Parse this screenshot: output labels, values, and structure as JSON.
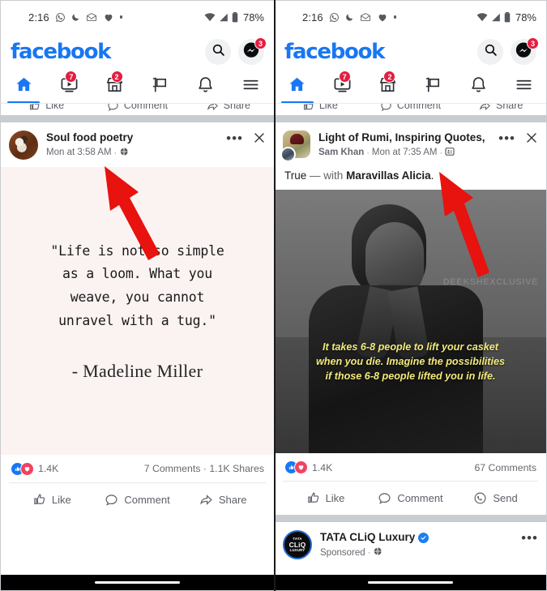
{
  "status_bar": {
    "time": "2:16",
    "battery_text": "78%",
    "left_icons": [
      "whatsapp-icon",
      "do-not-disturb-moon-icon",
      "email-icon",
      "heart-icon",
      "more-dot-icon"
    ],
    "right_icons": [
      "wifi-icon",
      "cellular-signal-icon",
      "battery-icon"
    ]
  },
  "app_bar": {
    "logo_text": "facebook",
    "logo_color": "#1877f2",
    "search_icon": "search-icon",
    "messenger_icon": "messenger-icon",
    "messenger_badge": "3",
    "badge_color": "#e41e3f"
  },
  "tabs": [
    {
      "name": "home",
      "icon": "home-icon",
      "badge": null,
      "selected": true
    },
    {
      "name": "video",
      "icon": "video-play-icon",
      "badge": "7",
      "selected": false
    },
    {
      "name": "marketplace",
      "icon": "marketplace-store-icon",
      "badge": "2",
      "selected": false
    },
    {
      "name": "groups",
      "icon": "groups-flag-icon",
      "badge": null,
      "selected": false
    },
    {
      "name": "notifications",
      "icon": "bell-icon",
      "badge": null,
      "selected": false
    },
    {
      "name": "menu",
      "icon": "hamburger-menu-icon",
      "badge": null,
      "selected": false
    }
  ],
  "clipped_actions": {
    "like": "Like",
    "comment": "Comment",
    "share": "Share"
  },
  "left_panel": {
    "post": {
      "avatar": "soul-food-poetry-avatar",
      "title": "Soul food poetry",
      "timestamp": "Mon at 3:58 AM",
      "separator": "·",
      "privacy_icon": "globe-public-icon",
      "more_icon": "more-options-icon",
      "close_icon": "close-icon",
      "quote_lines": [
        "\"Life is not so simple",
        "as a loom. What you",
        "weave, you cannot",
        "unravel with a tug.\""
      ],
      "quote_author": "- Madeline Miller",
      "card_bg": "#faf3f2"
    },
    "engagement": {
      "reactions_count": "1.4K",
      "reaction_icons": [
        "like-reaction-icon",
        "love-reaction-icon"
      ],
      "comments_shares": "7 Comments · 1.1K Shares"
    },
    "actions": {
      "like": "Like",
      "comment": "Comment",
      "share": "Share"
    }
  },
  "right_panel": {
    "post": {
      "avatar": "light-of-rumi-page-avatar",
      "mini_avatar": "sam-khan-profile-avatar",
      "title": "Light of Rumi, Inspiring Quotes,",
      "author": "Sam Khan",
      "timestamp": "Mon at 7:35 AM",
      "separator": "·",
      "privacy_icon": "custom-audience-icon",
      "more_icon": "more-options-icon",
      "close_icon": "close-icon",
      "body_prefix": "True",
      "body_dash": "—",
      "body_with": "with",
      "body_tagged": "Maravillas Alicia",
      "body_period": ".",
      "image_watermark": "DEEKSHEXCLUSIVE",
      "image_overlay_lines": [
        "It takes 6-8 people to lift your casket",
        "when you die. Imagine the possibilities",
        "if those 6-8 people lifted you in life."
      ],
      "overlay_color": "#f2ea7a"
    },
    "engagement": {
      "reactions_count": "1.4K",
      "reaction_icons": [
        "like-reaction-icon",
        "love-reaction-icon"
      ],
      "comments": "67 Comments"
    },
    "actions": {
      "like": "Like",
      "comment": "Comment",
      "send": "Send"
    },
    "sponsored_post": {
      "avatar": "tata-cliq-luxury-logo",
      "avatar_line1": "TATA",
      "avatar_line2": "CLiQ",
      "avatar_line3": "LUXURY",
      "title": "TATA CLiQ Luxury",
      "verified_icon": "verified-badge-icon",
      "label": "Sponsored",
      "separator": "·",
      "privacy_icon": "globe-public-icon",
      "more_icon": "more-options-icon"
    }
  },
  "annotations": {
    "arrow_color": "#e8120e",
    "left_arrow": "red-arrow-pointing-to-globe-privacy-icon",
    "right_arrow": "red-arrow-pointing-to-custom-audience-privacy-icon"
  }
}
